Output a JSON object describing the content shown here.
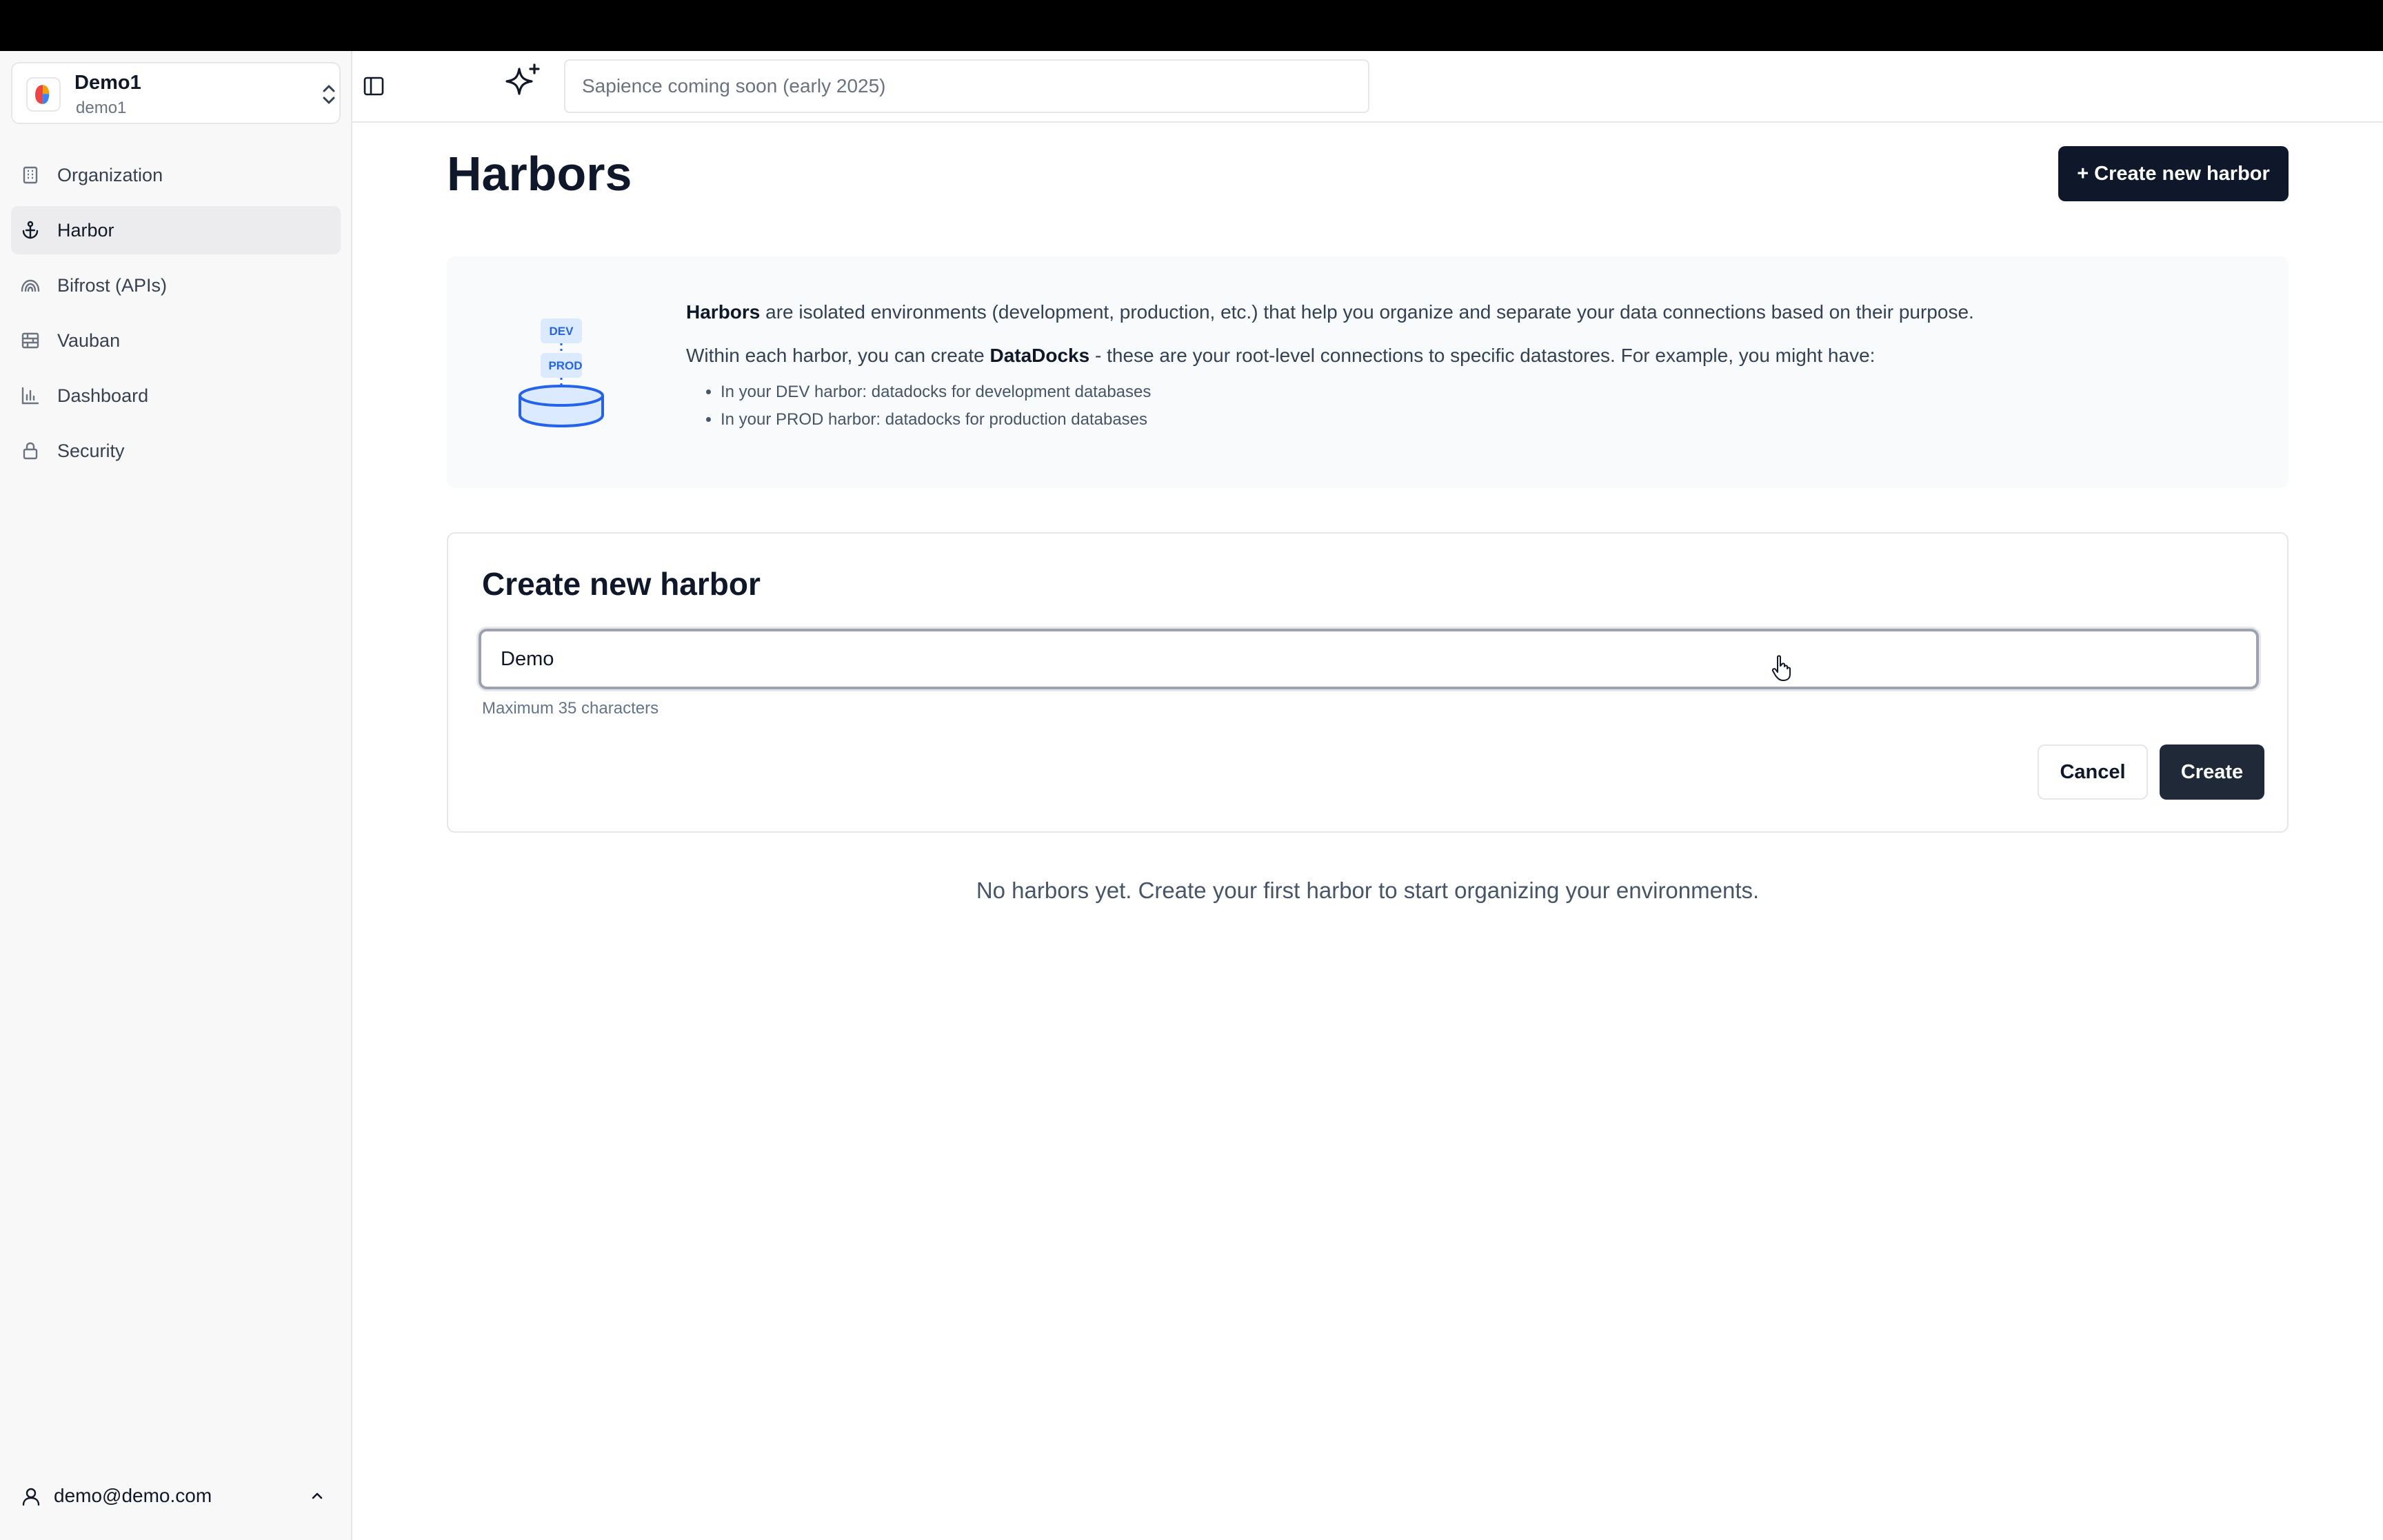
{
  "org": {
    "name": "Demo1",
    "slug": "demo1"
  },
  "sidebar": {
    "items": [
      {
        "label": "Organization",
        "icon": "building-icon",
        "active": false
      },
      {
        "label": "Harbor",
        "icon": "anchor-icon",
        "active": true
      },
      {
        "label": "Bifrost (APIs)",
        "icon": "rainbow-icon",
        "active": false
      },
      {
        "label": "Vauban",
        "icon": "brick-wall-icon",
        "active": false
      },
      {
        "label": "Dashboard",
        "icon": "bar-chart-icon",
        "active": false
      },
      {
        "label": "Security",
        "icon": "lock-icon",
        "active": false
      }
    ],
    "user_email": "demo@demo.com"
  },
  "header": {
    "ai_placeholder": "Sapience coming soon (early 2025)"
  },
  "main": {
    "title": "Harbors",
    "create_button": "+ Create new harbor",
    "info": {
      "p1_bold": "Harbors",
      "p1_rest": " are isolated environments (development, production, etc.) that help you organize and separate your data connections based on their purpose.",
      "p2_start": "Within each harbor, you can create ",
      "p2_bold": "DataDocks",
      "p2_rest": " - these are your root-level connections to specific datastores. For example, you might have:",
      "bullets": [
        "In your DEV harbor: datadocks for development databases",
        "In your PROD harbor: datadocks for production databases"
      ],
      "illustration_labels": {
        "dev": "DEV",
        "prod": "PROD"
      }
    },
    "form": {
      "title": "Create new harbor",
      "name_value": "Demo",
      "helper": "Maximum 35 characters",
      "cancel_label": "Cancel",
      "create_label": "Create"
    },
    "empty_state": "No harbors yet. Create your first harbor to start organizing your environments."
  },
  "colors": {
    "primary": "#0f172a",
    "create_button": "#1f2937",
    "sidebar_bg": "#f8f8f9",
    "info_bg": "#f8fafc",
    "accent_blue": "#3b82f6"
  }
}
